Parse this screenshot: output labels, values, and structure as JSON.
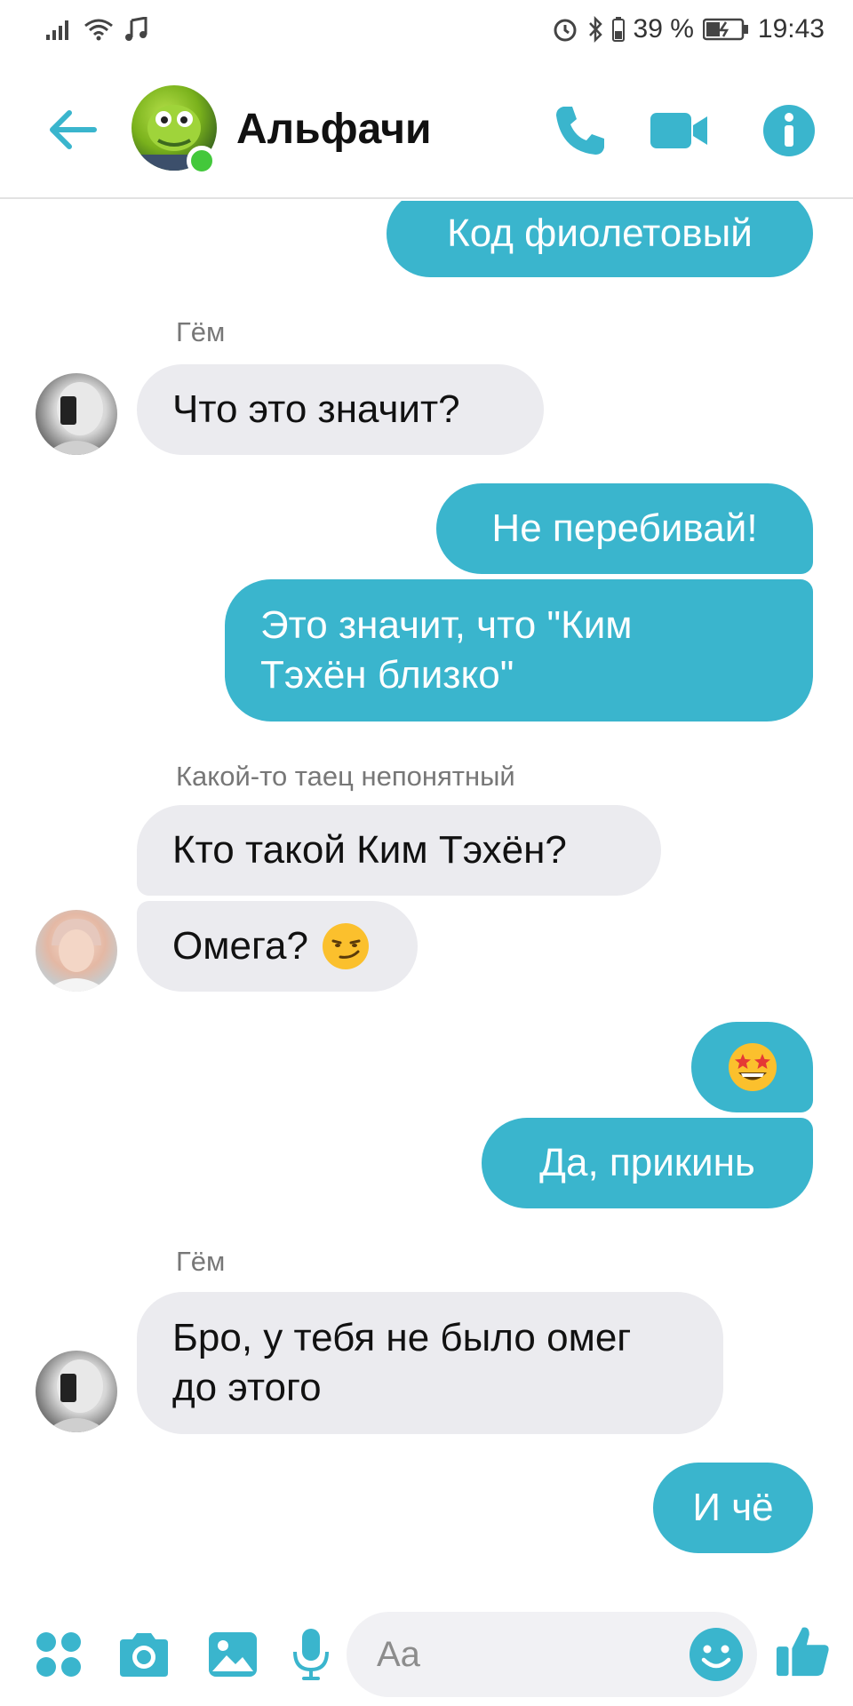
{
  "status_bar": {
    "battery_percent": "39 %",
    "time": "19:43"
  },
  "header": {
    "title": "Альфачи",
    "online": true
  },
  "messages": [
    {
      "direction": "out",
      "text": "Код фиолетовый"
    },
    {
      "direction": "in",
      "sender": "Гём",
      "text": "Что это значит?"
    },
    {
      "direction": "out",
      "text": "Не перебивай!"
    },
    {
      "direction": "out",
      "lines": [
        "Это значит, что \"Ким",
        "Тэхён близко\""
      ]
    },
    {
      "direction": "in",
      "sender": "Какой-то таец непонятный",
      "text": "Кто такой Ким Тэхён?"
    },
    {
      "direction": "in",
      "text": "Омега?",
      "emoji": "smirking-face"
    },
    {
      "direction": "out",
      "emoji": "star-struck-face"
    },
    {
      "direction": "out",
      "text": "Да, прикинь"
    },
    {
      "direction": "in",
      "sender": "Гём",
      "lines": [
        "Бро, у тебя не было омег",
        "до этого"
      ]
    },
    {
      "direction": "out",
      "text": "И чё"
    }
  ],
  "composer": {
    "placeholder": "Aa"
  },
  "colors": {
    "accent": "#3ab5cd",
    "incoming_bubble": "#ebebef",
    "online": "#43c83b"
  }
}
